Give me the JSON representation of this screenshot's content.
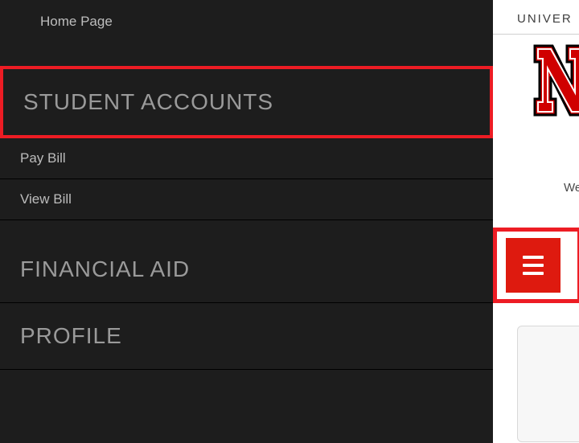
{
  "sidebar": {
    "home": "Home Page",
    "student_accounts_header": "Student Accounts",
    "pay_bill": "Pay Bill",
    "view_bill": "View Bill",
    "financial_aid_header": "Financial Aid",
    "profile_header": "Profile"
  },
  "right": {
    "univ_label": "UNIVER",
    "welcome_fragment": "We"
  },
  "colors": {
    "accent_red": "#ed1c24",
    "button_red": "#de1a0f",
    "sidebar_bg": "#1d1d1d"
  }
}
